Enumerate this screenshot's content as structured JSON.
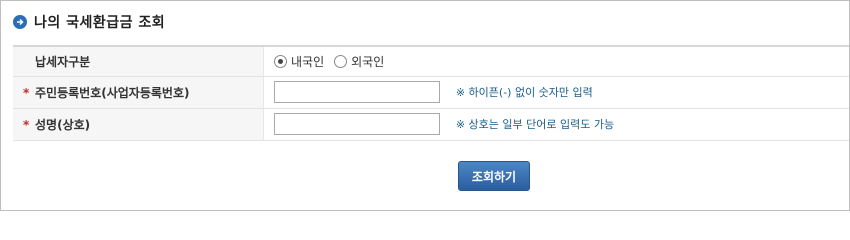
{
  "header": {
    "icon": "arrow-right-circle-icon",
    "title": "나의 국세환급금 조회"
  },
  "form": {
    "rows": [
      {
        "label": "납세자구분",
        "required": false,
        "options": [
          {
            "label": "내국인",
            "selected": true
          },
          {
            "label": "외국인",
            "selected": false
          }
        ]
      },
      {
        "label": "주민등록번호(사업자등록번호)",
        "required": true,
        "required_mark": "*",
        "value": "",
        "hint": "※ 하이픈(-) 없이 숫자만 입력"
      },
      {
        "label": "성명(상호)",
        "required": true,
        "required_mark": "*",
        "value": "",
        "hint": "※ 상호는 일부 단어로 입력도 가능"
      }
    ]
  },
  "actions": {
    "submit_label": "조회하기"
  },
  "colors": {
    "accent": "#2a6fb6",
    "required": "#c0272d",
    "hint": "#1a5f8a",
    "button": "#2a5e9e"
  }
}
